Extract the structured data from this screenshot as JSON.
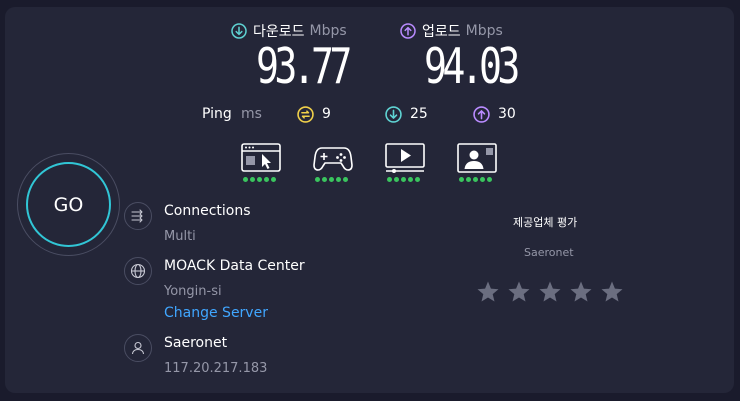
{
  "download": {
    "label": "다운로드",
    "unit": "Mbps",
    "value": "93.77",
    "icon": "arrow-down-circle-icon",
    "color": "#5fd3d3"
  },
  "upload": {
    "label": "업로드",
    "unit": "Mbps",
    "value": "94.03",
    "icon": "arrow-up-circle-icon",
    "color": "#b98bff"
  },
  "ping": {
    "label": "Ping",
    "unit": "ms",
    "idle": {
      "value": "9",
      "icon": "ping-idle-icon",
      "color": "#f0d04a"
    },
    "download": {
      "value": "25",
      "icon": "arrow-down-circle-icon",
      "color": "#5fd3d3"
    },
    "upload": {
      "value": "30",
      "icon": "arrow-up-circle-icon",
      "color": "#b98bff"
    }
  },
  "quality": [
    {
      "icon": "web-browsing-icon",
      "rating": 5
    },
    {
      "icon": "gamepad-icon",
      "rating": 5
    },
    {
      "icon": "video-streaming-icon",
      "rating": 5
    },
    {
      "icon": "video-call-icon",
      "rating": 5
    }
  ],
  "go_button": {
    "label": "GO"
  },
  "connections": {
    "title": "Connections",
    "value": "Multi",
    "icon": "connections-icon"
  },
  "server": {
    "title": "MOACK Data Center",
    "location": "Yongin-si",
    "change_label": "Change Server",
    "icon": "globe-icon"
  },
  "provider": {
    "title": "Saeronet",
    "ip": "117.20.217.183",
    "icon": "person-icon"
  },
  "rating": {
    "title": "제공업체 평가",
    "provider": "Saeronet",
    "stars": 5,
    "star_color": "#6b6e80"
  }
}
